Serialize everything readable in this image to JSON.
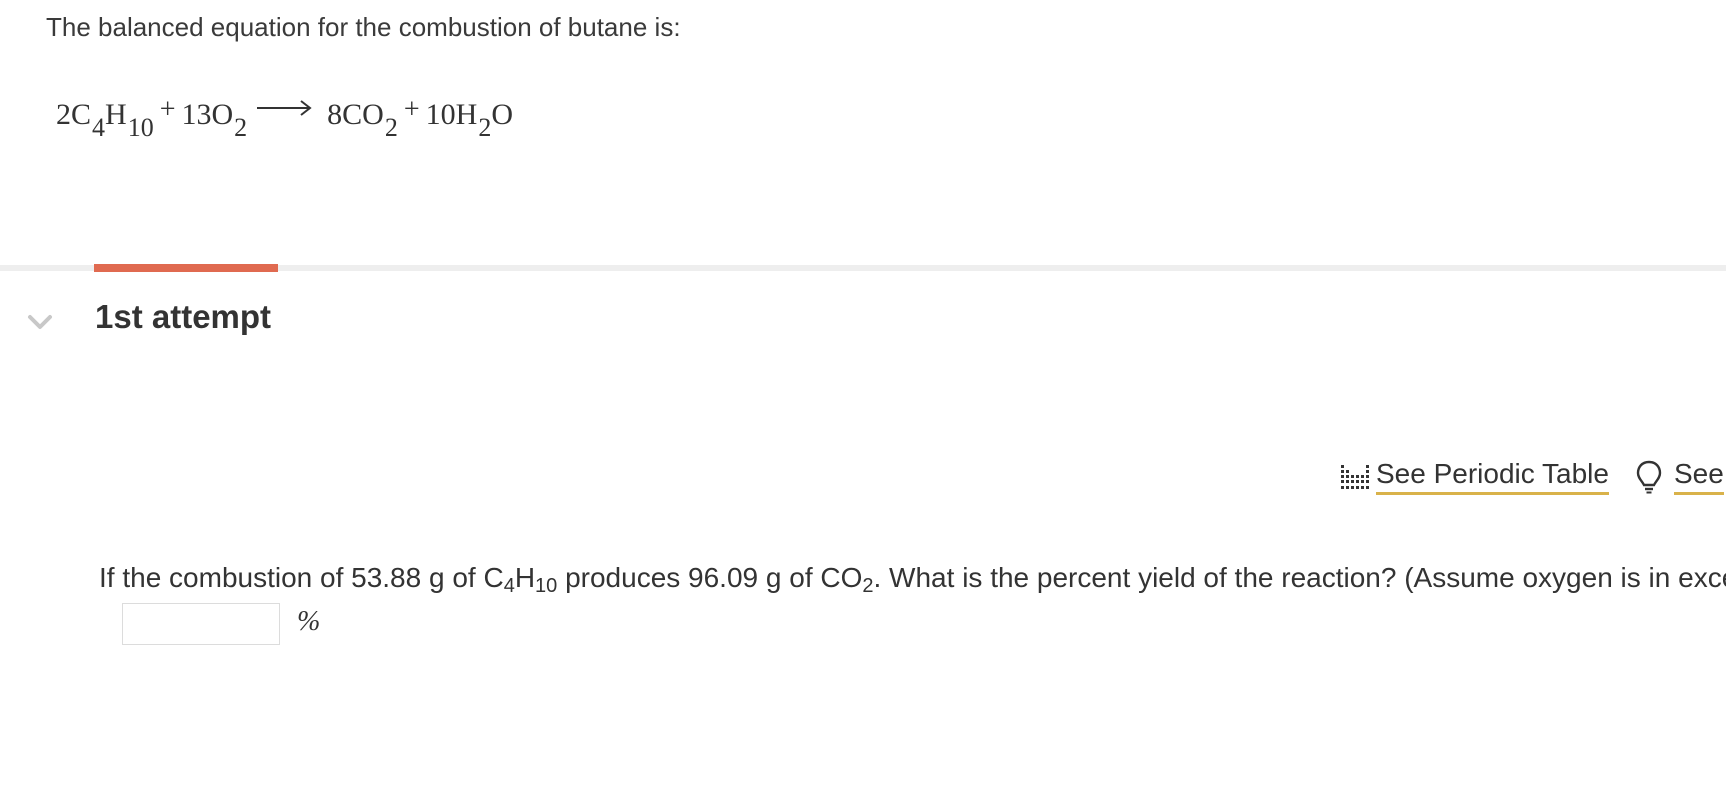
{
  "problem": {
    "intro": "The balanced equation for the combustion of butane is:",
    "equation": {
      "reactant1_coef": "2C",
      "reactant1_sub1": "4",
      "reactant1_el2": "H",
      "reactant1_sub2": "10",
      "plus": "+",
      "reactant2_coef": "13O",
      "reactant2_sub": "2",
      "product1_coef": "8CO",
      "product1_sub": "2",
      "product2_coef": "10H",
      "product2_sub": "2",
      "product2_el2": "O"
    }
  },
  "attempt": {
    "title": "1st attempt"
  },
  "toolbar": {
    "periodic_table_label": "See Periodic Table",
    "hint_label": "See"
  },
  "question": {
    "text_part1": "If the combustion of 53.88 g of C",
    "sub1": "4",
    "text_part2": "H",
    "sub2": "10",
    "text_part3": " produces 96.09 g of CO",
    "sub3": "2",
    "text_part4": ". What is the percent yield of the reaction?  (Assume oxygen is in exce",
    "answer_value": "",
    "unit": "%"
  },
  "colors": {
    "accent_tab": "#e06a50",
    "link_underline": "#d9b24a",
    "divider": "#eeeeee"
  }
}
